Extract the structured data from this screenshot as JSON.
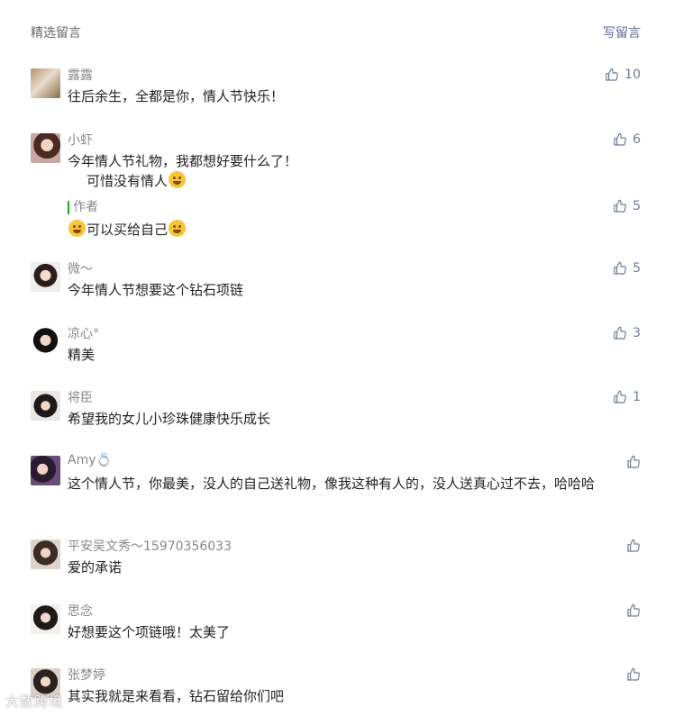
{
  "header": {
    "title": "精选留言",
    "write_label": "写留言"
  },
  "comments": [
    {
      "name": "露露",
      "text": "往后余生，全都是你，情人节快乐！",
      "likes": "10"
    },
    {
      "name": "小虾",
      "text": "今年情人节礼物，我都想好要什么了！",
      "text2": "可惜没有情人",
      "likes": "6",
      "author_tag": "作者",
      "author_reply": "可以买给自己",
      "author_likes": "5"
    },
    {
      "name": "微～",
      "text": "今年情人节想要这个钻石项链",
      "likes": "5"
    },
    {
      "name": "凉心°",
      "text": "精美",
      "likes": "3"
    },
    {
      "name": "将臣",
      "text": "希望我的女儿小珍珠健康快乐成长",
      "likes": "1"
    },
    {
      "name": "Amy💍",
      "text": "这个情人节，你最美，没人的自己送礼物，像我这种有人的，没人送真心过不去，哈哈哈",
      "likes": ""
    },
    {
      "name": "平安吴文秀～15970356033",
      "text": "爱的承诺",
      "likes": ""
    },
    {
      "name": "思念",
      "text": "好想要这个项链哦！太美了",
      "likes": ""
    },
    {
      "name": "张梦婷",
      "text": "其实我就是来看看，钻石留给你们吧",
      "likes": ""
    }
  ],
  "watermark": "大数跨境"
}
